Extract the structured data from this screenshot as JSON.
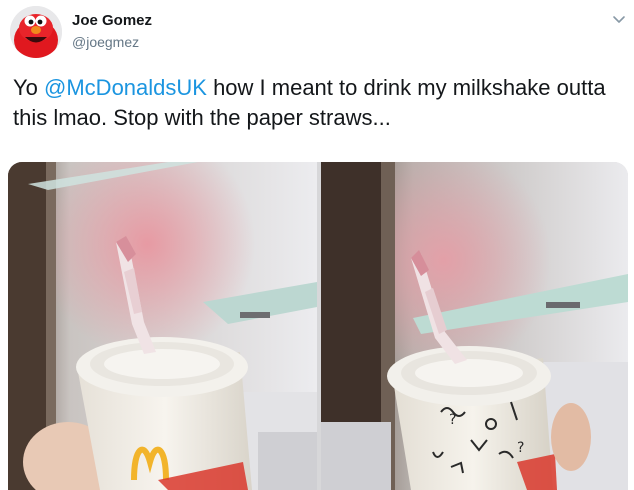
{
  "tweet": {
    "author": {
      "display_name": "Joe Gomez",
      "handle": "@joegmez",
      "avatar_icon": "elmo-avatar-icon"
    },
    "menu_icon": "chevron-down-icon",
    "text": {
      "prefix": "Yo ",
      "mention": "@McDonaldsUK",
      "body": " how I meant to drink my milkshake outta this lmao. Stop with the paper straws..."
    },
    "media": [
      {
        "label": "milkshake cup with collapsed paper straw, McDonald's logo"
      },
      {
        "label": "milkshake cup with collapsed paper straw, doodle print"
      }
    ]
  },
  "colors": {
    "mention": "#1b95e0",
    "text": "#14171a",
    "secondary_text": "#657786",
    "mcdonalds_gold": "#f2b42b"
  }
}
